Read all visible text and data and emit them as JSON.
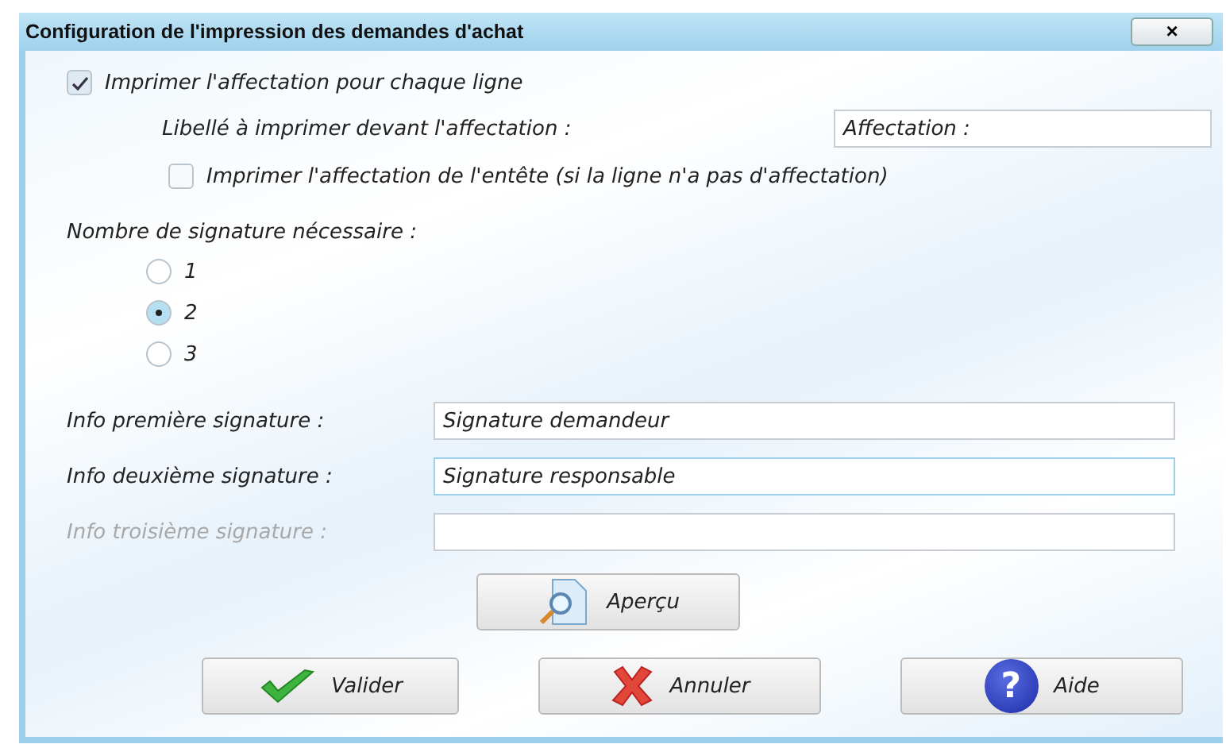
{
  "window": {
    "title": "Configuration de l'impression des demandes d'achat",
    "close_glyph": "×"
  },
  "print_assignment": {
    "label": "Imprimer l'affectation pour chaque ligne",
    "checked": true
  },
  "assignment_label": {
    "label": "Libellé à imprimer devant l'affectation :",
    "value": "Affectation :"
  },
  "print_header_assignment": {
    "label": "Imprimer l'affectation de l'entête (si la ligne n'a pas d'affectation)",
    "checked": false
  },
  "signature_count": {
    "label": "Nombre de signature nécessaire :",
    "options": [
      {
        "label": "1",
        "selected": false
      },
      {
        "label": "2",
        "selected": true
      },
      {
        "label": "3",
        "selected": false
      }
    ]
  },
  "signature_fields": [
    {
      "label": "Info première signature :",
      "value": "Signature demandeur",
      "disabled": false,
      "focused": false
    },
    {
      "label": "Info deuxième signature :",
      "value": "Signature responsable",
      "disabled": false,
      "focused": true
    },
    {
      "label": "Info troisième signature :",
      "disabled": true,
      "focused": false
    }
  ],
  "preview_button": {
    "label": "Aperçu",
    "kind": "preview"
  },
  "buttons": [
    {
      "label": "Valider",
      "kind": "ok"
    },
    {
      "label": "Annuler",
      "kind": "cancel"
    },
    {
      "label": "Aide",
      "kind": "help",
      "glyph": "?"
    }
  ]
}
